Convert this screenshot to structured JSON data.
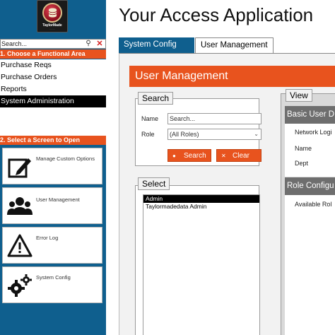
{
  "logo": {
    "brand_text": "TaylorMade"
  },
  "nav": {
    "search_placeholder": "Search...",
    "search_icon": "magnifier-icon",
    "clear_icon": "x-icon",
    "area_header": "1.  Choose a Functional Area",
    "areas": [
      {
        "label": "Purchase Reqs",
        "selected": false
      },
      {
        "label": "Purchase Orders",
        "selected": false
      },
      {
        "label": "Reports",
        "selected": false
      },
      {
        "label": "System Administration",
        "selected": true
      }
    ],
    "screen_header": "2.  Select a Screen to Open",
    "screens": [
      {
        "label": "Manage Custom Options",
        "icon": "edit-icon"
      },
      {
        "label": "User Management",
        "icon": "users-icon"
      },
      {
        "label": "Error Log",
        "icon": "warning-icon"
      },
      {
        "label": "System Config",
        "icon": "gears-icon"
      }
    ]
  },
  "header": {
    "title": "Your Access Application"
  },
  "tabs": [
    {
      "label": "System Config",
      "active": false
    },
    {
      "label": "User Management",
      "active": true
    }
  ],
  "form": {
    "title": "User Management",
    "search": {
      "group_label": "Search",
      "name_label": "Name",
      "name_placeholder": "Search...",
      "role_label": "Role",
      "role_value": "(All Roles)",
      "search_button": "Search",
      "clear_button": "Clear"
    },
    "select": {
      "group_label": "Select",
      "users": [
        {
          "name": "Admin",
          "selected": true
        },
        {
          "name": "Taylormadedata Admin",
          "selected": false
        }
      ]
    },
    "view": {
      "group_label": "View",
      "basic_header": "Basic User D",
      "fields": [
        "Network Logi",
        "Name",
        "Dept"
      ],
      "role_header": "Role Configu",
      "role_field": "Available Rol"
    }
  },
  "colors": {
    "nav_blue": "#0f5f8e",
    "accent_orange": "#e8531e",
    "view_header_gray": "#6e6e6e"
  }
}
